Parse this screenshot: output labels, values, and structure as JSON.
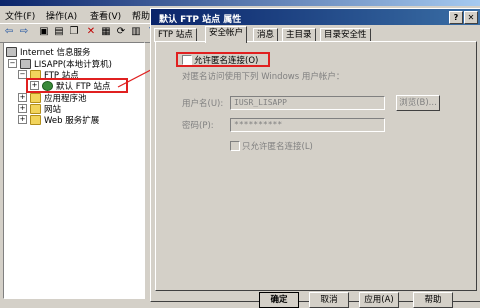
{
  "mmc": {
    "menu": [
      "文件(F)",
      "操作(A)",
      "查看(V)",
      "帮助"
    ],
    "tree": {
      "root": "Internet 信息服务",
      "computer": "LISAPP(本地计算机)",
      "ftp_sites": "FTP 站点",
      "default_ftp_site": "默认 FTP 站点",
      "app_pools": "应用程序池",
      "websites": "网站",
      "web_extensions": "Web 服务扩展"
    }
  },
  "dialog": {
    "title": "默认 FTP 站点 属性",
    "tabs": [
      "FTP 站点",
      "安全帐户",
      "消息",
      "主目录",
      "目录安全性"
    ],
    "active_tab": "安全帐户",
    "allow_anonymous_label": "允许匿名连接(O)",
    "anonymous_hint": "对匿名访问使用下列 Windows 用户帐户：",
    "username_label": "用户名(U):",
    "username_value": "IUSR_LISAPP",
    "browse_label": "浏览(B)...",
    "password_label": "密码(P):",
    "password_value": "**********",
    "only_anonymous_label": "只允许匿名连接(L)",
    "buttons": {
      "ok": "确定",
      "cancel": "取消",
      "apply": "应用(A)",
      "help": "帮助"
    }
  },
  "colors": {
    "highlight": "#e02020",
    "title_bar": "#0a246a",
    "face": "#d4d0c8"
  }
}
